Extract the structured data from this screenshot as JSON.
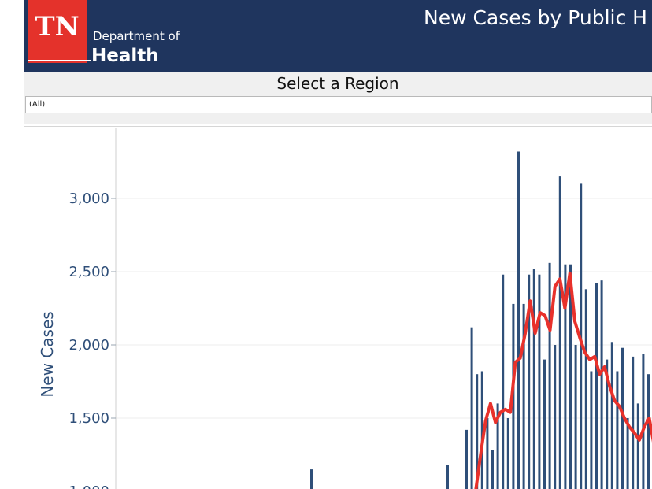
{
  "header": {
    "logo_tn": "TN",
    "logo_dept": "Department of",
    "logo_health": "Health",
    "title": "New Cases by Public H",
    "bg_color": "#1f355e",
    "logo_color": "#e4322b"
  },
  "filter": {
    "label": "Select a Region",
    "selected": "(All)"
  },
  "chart_data": {
    "type": "bar",
    "ylabel": "New Cases",
    "y_ticks": [
      1000,
      1500,
      2000,
      2500,
      3000
    ],
    "y_tick_labels": [
      "1,000",
      "1,500",
      "2,000",
      "2,500",
      "3,000"
    ],
    "ylim": [
      1000,
      3400
    ],
    "bar_color": "#2f4f79",
    "line_color": "#e8312b",
    "grid": true,
    "bars": [
      {
        "x": 0,
        "y": 1150
      },
      {
        "x": 1,
        "y": 1180
      },
      {
        "x": 2,
        "y": 1420
      },
      {
        "x": 3,
        "y": 2120
      },
      {
        "x": 4,
        "y": 1800
      },
      {
        "x": 5,
        "y": 1820
      },
      {
        "x": 6,
        "y": 1500
      },
      {
        "x": 7,
        "y": 1280
      },
      {
        "x": 8,
        "y": 1600
      },
      {
        "x": 9,
        "y": 2480
      },
      {
        "x": 10,
        "y": 1500
      },
      {
        "x": 11,
        "y": 2280
      },
      {
        "x": 12,
        "y": 3320
      },
      {
        "x": 13,
        "y": 2280
      },
      {
        "x": 14,
        "y": 2480
      },
      {
        "x": 15,
        "y": 2520
      },
      {
        "x": 16,
        "y": 2480
      },
      {
        "x": 17,
        "y": 1900
      },
      {
        "x": 18,
        "y": 2560
      },
      {
        "x": 19,
        "y": 2000
      },
      {
        "x": 20,
        "y": 3150
      },
      {
        "x": 21,
        "y": 2550
      },
      {
        "x": 22,
        "y": 2550
      },
      {
        "x": 23,
        "y": 2000
      },
      {
        "x": 24,
        "y": 3100
      },
      {
        "x": 25,
        "y": 2380
      },
      {
        "x": 26,
        "y": 1820
      },
      {
        "x": 27,
        "y": 2420
      },
      {
        "x": 28,
        "y": 2440
      },
      {
        "x": 29,
        "y": 1900
      },
      {
        "x": 30,
        "y": 2020
      },
      {
        "x": 31,
        "y": 1820
      },
      {
        "x": 32,
        "y": 1980
      },
      {
        "x": 33,
        "y": 1500
      },
      {
        "x": 34,
        "y": 1920
      },
      {
        "x": 35,
        "y": 1600
      },
      {
        "x": 36,
        "y": 1940
      },
      {
        "x": 37,
        "y": 1800
      }
    ],
    "bar_x_pixels_note": "",
    "rolling_avg": [
      {
        "x": 0,
        "y": 1000
      },
      {
        "x": 1,
        "y": 1250
      },
      {
        "x": 2,
        "y": 1480
      },
      {
        "x": 3,
        "y": 1600
      },
      {
        "x": 4,
        "y": 1470
      },
      {
        "x": 5,
        "y": 1540
      },
      {
        "x": 6,
        "y": 1560
      },
      {
        "x": 7,
        "y": 1540
      },
      {
        "x": 8,
        "y": 1880
      },
      {
        "x": 9,
        "y": 1910
      },
      {
        "x": 10,
        "y": 2080
      },
      {
        "x": 11,
        "y": 2300
      },
      {
        "x": 12,
        "y": 2080
      },
      {
        "x": 13,
        "y": 2220
      },
      {
        "x": 14,
        "y": 2200
      },
      {
        "x": 15,
        "y": 2100
      },
      {
        "x": 16,
        "y": 2400
      },
      {
        "x": 17,
        "y": 2450
      },
      {
        "x": 18,
        "y": 2250
      },
      {
        "x": 19,
        "y": 2490
      },
      {
        "x": 20,
        "y": 2160
      },
      {
        "x": 21,
        "y": 2050
      },
      {
        "x": 22,
        "y": 1950
      },
      {
        "x": 23,
        "y": 1900
      },
      {
        "x": 24,
        "y": 1920
      },
      {
        "x": 25,
        "y": 1800
      },
      {
        "x": 26,
        "y": 1850
      },
      {
        "x": 27,
        "y": 1720
      },
      {
        "x": 28,
        "y": 1620
      },
      {
        "x": 29,
        "y": 1580
      },
      {
        "x": 30,
        "y": 1500
      },
      {
        "x": 31,
        "y": 1440
      },
      {
        "x": 32,
        "y": 1400
      },
      {
        "x": 33,
        "y": 1350
      },
      {
        "x": 34,
        "y": 1440
      },
      {
        "x": 35,
        "y": 1500
      },
      {
        "x": 36,
        "y": 1310
      },
      {
        "x": 37,
        "y": 1420
      }
    ],
    "early_bars": [
      {
        "x": 0,
        "y": 1150
      },
      {
        "x": 1,
        "y": 1180
      }
    ]
  }
}
